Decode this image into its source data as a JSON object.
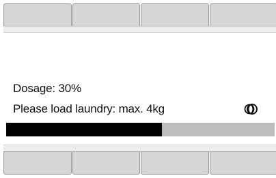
{
  "status": {
    "dosage_text": "Dosage: 30%",
    "load_text": "Please load laundry: max. 4kg"
  },
  "progress": {
    "fraction": 0.58
  },
  "icons": {
    "drum": "laundry-drum-icon"
  },
  "colors": {
    "progress_fill": "#000000",
    "progress_track": "#bdbdbd",
    "button_face": "#d6d6d6"
  }
}
